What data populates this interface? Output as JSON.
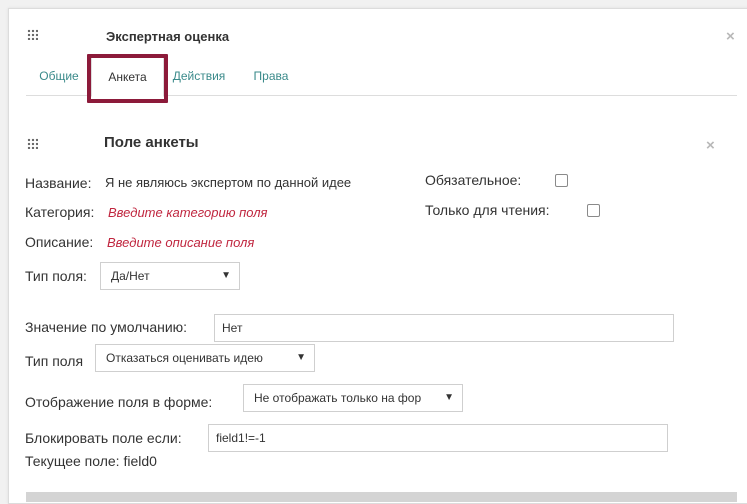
{
  "window": {
    "title": "Экспертная оценка",
    "close": "×"
  },
  "tabs": [
    {
      "label": "Общие"
    },
    {
      "label": "Анкета"
    },
    {
      "label": "Действия"
    },
    {
      "label": "Права"
    }
  ],
  "active_tab": "Анкета",
  "section": {
    "title": "Поле анкеты",
    "close": "×"
  },
  "form": {
    "name_label": "Название:",
    "name_value": "Я не являюсь экспертом по данной идее",
    "category_label": "Категория:",
    "category_placeholder": "Введите категорию поля",
    "description_label": "Описание:",
    "description_placeholder": "Введите описание поля",
    "required_label": "Обязательное:",
    "required_checked": false,
    "readonly_label": "Только для чтения:",
    "readonly_checked": false,
    "field_type_label": "Тип поля:",
    "field_type_value": "Да/Нет",
    "default_label": "Значение по умолчанию:",
    "default_value": "Нет",
    "field_type2_label": "Тип поля",
    "field_type2_value": "Отказаться оценивать идею",
    "display_label": "Отображение поля в форме:",
    "display_value": "Не отображать только на фор",
    "block_label": "Блокировать поле если:",
    "block_value": "field1!=-1",
    "current_field_text": "Текущее поле: field0"
  },
  "colors": {
    "accent_link": "#c0263f",
    "tab_link": "#3a8a8a",
    "highlight_border": "#8c1a3a"
  },
  "icons": {
    "grip": "grip-dots-icon",
    "close": "close-icon",
    "dropdown": "caret-down-icon"
  }
}
